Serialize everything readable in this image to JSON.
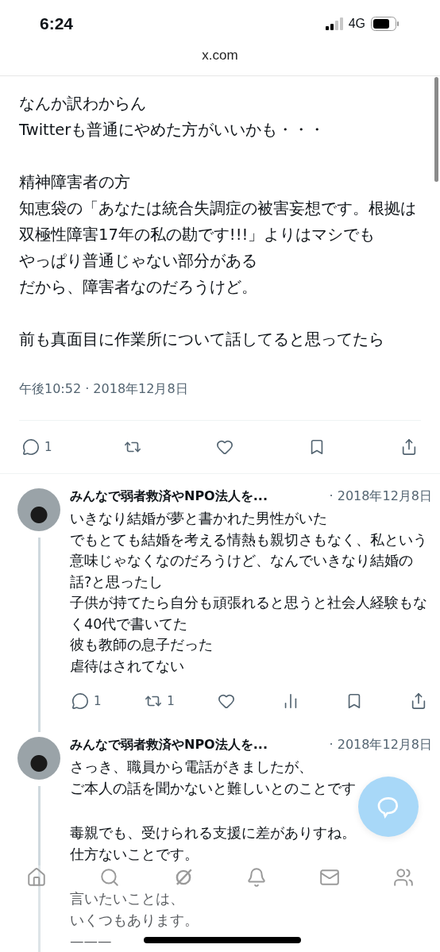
{
  "status_bar": {
    "time": "6:24",
    "network": "4G"
  },
  "browser": {
    "url": "x.com"
  },
  "tweet": {
    "paragraphs": [
      [
        "なんか訳わからん",
        "Twitterも普通にやめた方がいいかも・・・"
      ],
      [
        "精神障害者の方",
        "知恵袋の「あなたは統合失調症の被害妄想です。根拠は双極性障害17年の私の勘です!!!」よりはマシでも",
        "やっぱり普通じゃない部分がある",
        "だから、障害者なのだろうけど。"
      ],
      [
        "前も真面目に作業所について話してると思ってたら"
      ]
    ],
    "timestamp": "午後10:52 · 2018年12月8日",
    "actions": [
      {
        "kind": "reply",
        "count": "1"
      },
      {
        "kind": "retweet"
      },
      {
        "kind": "like"
      },
      {
        "kind": "bookmark"
      },
      {
        "kind": "share"
      }
    ]
  },
  "replies": [
    {
      "author": "みんなで弱者救済やNPO法人を...",
      "date": "· 2018年12月8日",
      "paragraphs": [
        [
          "いきなり結婚が夢と書かれた男性がいた",
          "でもとても結婚を考える情熱も親切さもなく、私という意味じゃなくなのだろうけど、なんでいきなり結婚の話?と思ったし",
          "子供が持てたら自分も頑張れると思うと社会人経験もなく40代で書いてた",
          "彼も教師の息子だった",
          "虐待はされてない"
        ]
      ],
      "actions": [
        {
          "kind": "reply",
          "count": "1"
        },
        {
          "kind": "retweet",
          "count": "1"
        },
        {
          "kind": "like"
        },
        {
          "kind": "views"
        },
        {
          "kind": "bookmark"
        },
        {
          "kind": "share"
        }
      ]
    },
    {
      "author": "みんなで弱者救済やNPO法人を...",
      "date": "· 2018年12月8日",
      "paragraphs": [
        [
          "さっき、職員から電話がきましたが、",
          "ご本人の話を聞かないと難しいとのことです"
        ],
        [
          "毒親でも、受けられる支援に差がありすね。",
          "仕方ないことです。"
        ],
        [
          "言いたいことは、",
          "いくつもあります。",
          "———"
        ]
      ]
    }
  ],
  "bottom_nav": [
    {
      "kind": "home"
    },
    {
      "kind": "search"
    },
    {
      "kind": "grok"
    },
    {
      "kind": "notifications"
    },
    {
      "kind": "messages"
    },
    {
      "kind": "communities"
    }
  ]
}
